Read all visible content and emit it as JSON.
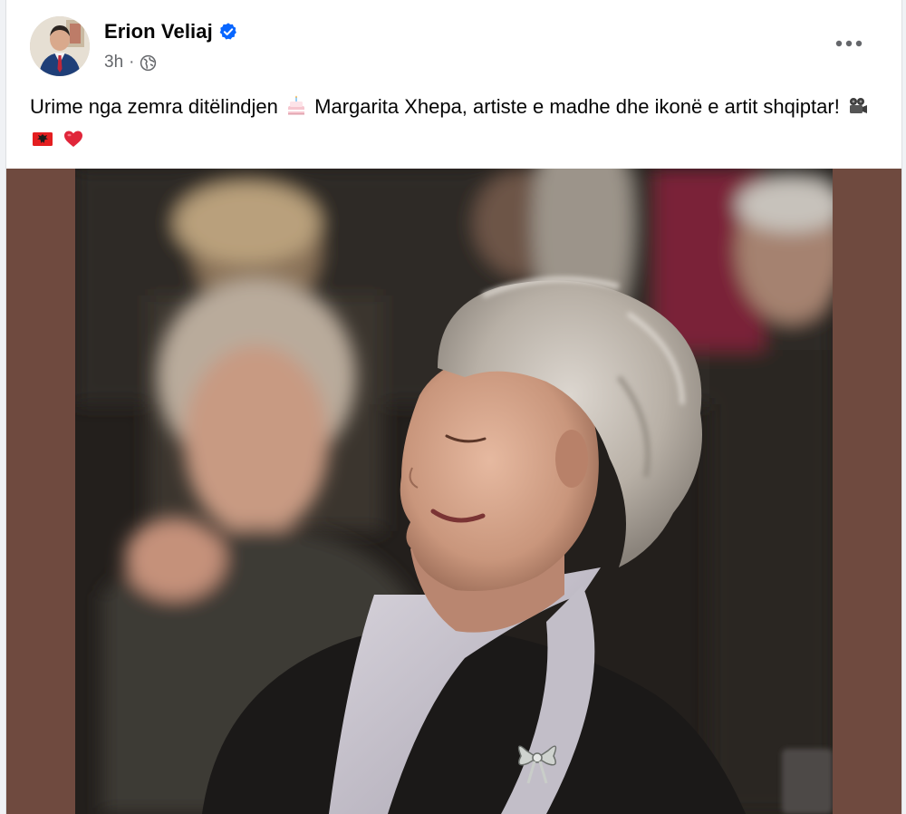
{
  "post": {
    "author": {
      "name": "Erion Veliaj",
      "verified": true
    },
    "meta": {
      "time": "3h",
      "separator": "·",
      "audience_icon": "globe-icon"
    },
    "more_icon": "more-options-icon",
    "caption": {
      "part1": "Urime nga zemra ditëlindjen",
      "part2": "Margarita Xhepa, artiste e madhe dhe ikonë e artit shqiptar!",
      "emojis": [
        "birthday-cake-emoji",
        "movie-camera-emoji",
        "albanian-flag-emoji",
        "red-heart-emoji"
      ]
    },
    "media": {
      "background_color": "#6f4a3f",
      "photo_icon": "portrait-photo"
    }
  },
  "colors": {
    "text_primary": "#050505",
    "text_secondary": "#65676b",
    "verified_blue": "#0866ff",
    "page_background": "#f0f2f5"
  }
}
